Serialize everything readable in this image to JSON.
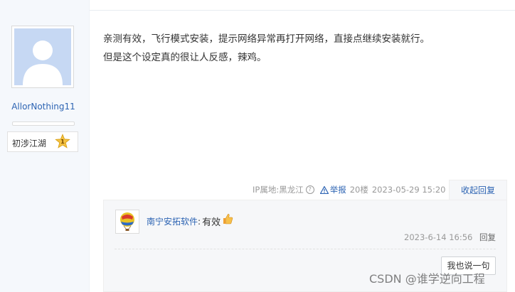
{
  "top_hint": "… ",
  "author": {
    "username": "AllorNothing11",
    "rank_label": "初涉江湖",
    "rank_level": "1",
    "exp_progress": 0
  },
  "post": {
    "lines": [
      "亲测有效，飞行模式安装，提示网络异常再打开网络，直接点继续安装就行。",
      "但是这个设定真的很让人反感，辣鸡。"
    ],
    "ip_location": "IP属地:黑龙江",
    "help_icon": "question-icon",
    "report_label": "举报",
    "floor": "20楼",
    "datetime": "2023-05-29 15:20",
    "collapse_label": "收起回复"
  },
  "reply": {
    "user": "南宁安拓软件",
    "separator": ":",
    "text": "有效",
    "emoji": "thumbs-up-icon",
    "datetime": "2023-6-14 16:56",
    "reply_label": "回复",
    "say_button": "我也说一句"
  },
  "watermark": "CSDN @谁学逆向工程",
  "colors": {
    "link": "#2d64b3",
    "sidebar_bg": "#f5f8fc",
    "reply_bg": "#f6f7f9",
    "meta_text": "#999999"
  }
}
